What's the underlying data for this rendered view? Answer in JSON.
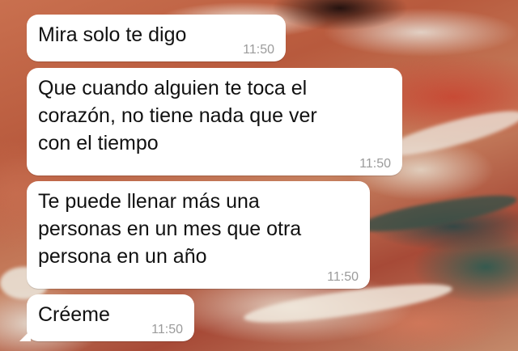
{
  "messages": [
    {
      "lines": [
        "Mira solo te digo"
      ],
      "time": "11:50"
    },
    {
      "lines": [
        "Que cuando alguien te toca el",
        "corazón, no tiene nada que ver",
        "con el tiempo"
      ],
      "time": "11:50"
    },
    {
      "lines": [
        "Te puede llenar más una",
        "personas en un mes que otra",
        "persona en un año"
      ],
      "time": "11:50"
    },
    {
      "lines": [
        "Créeme"
      ],
      "time": "11:50"
    }
  ],
  "colors": {
    "bubble": "#ffffff",
    "timestamp": "#9b9b9b",
    "text": "#111111"
  }
}
